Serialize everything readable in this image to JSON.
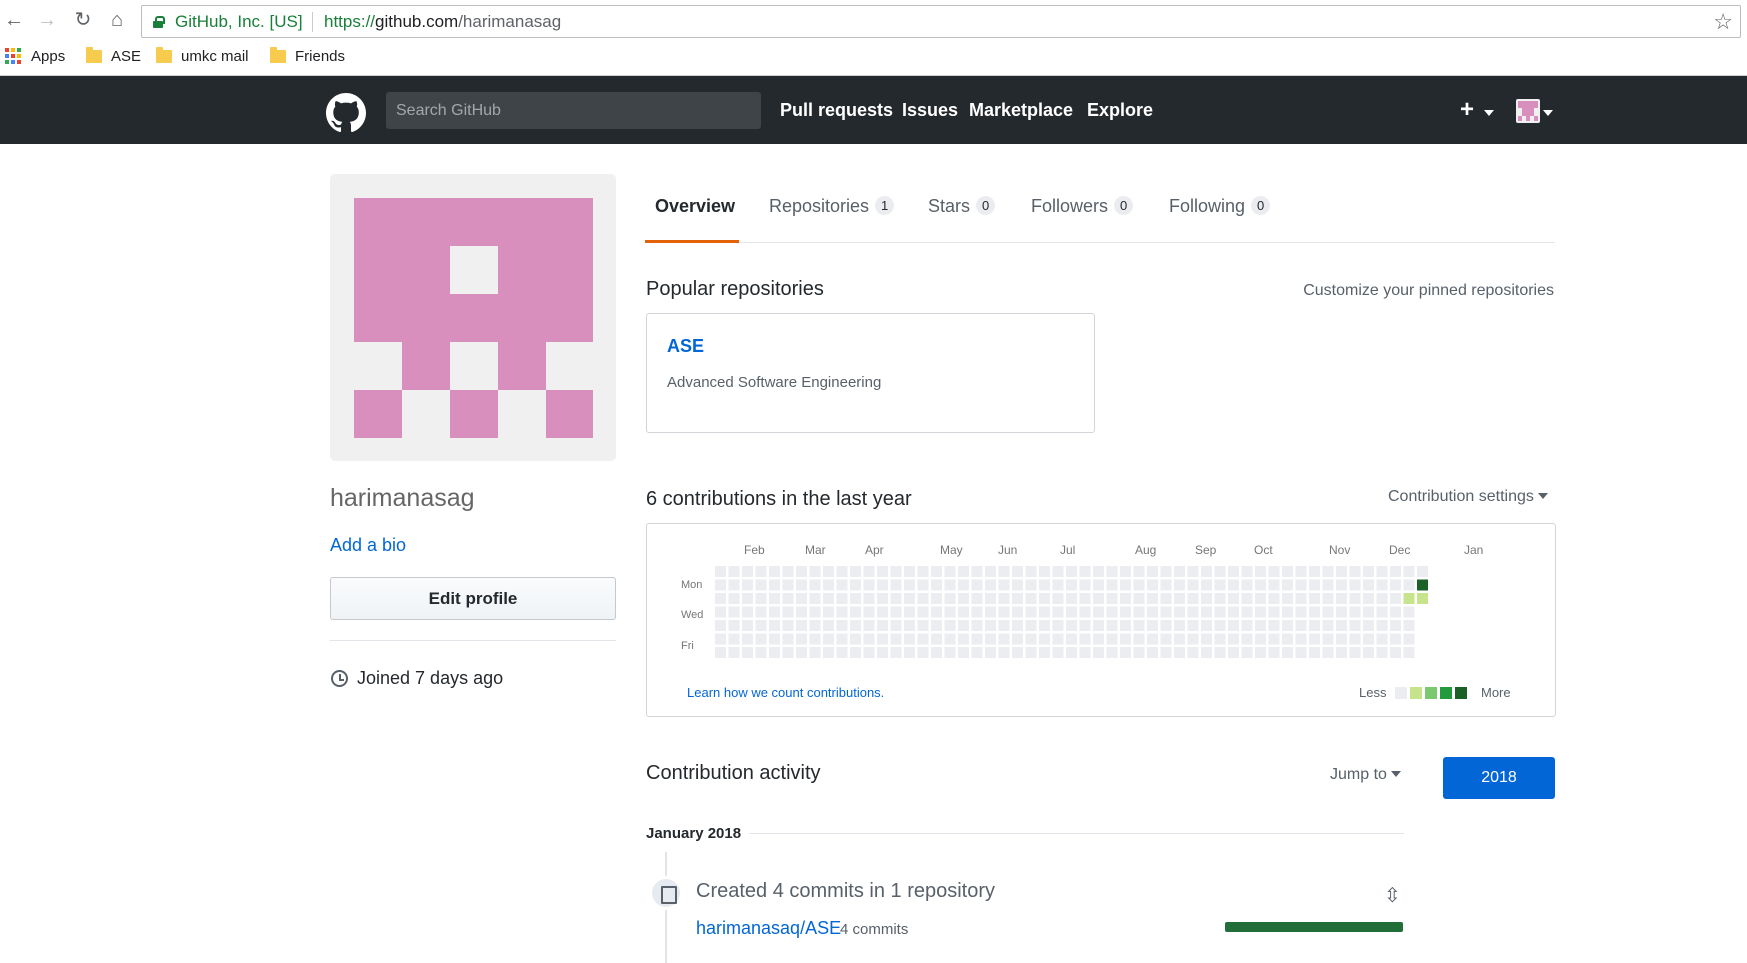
{
  "browser": {
    "site_identity": "GitHub, Inc. [US]",
    "url_scheme": "https://",
    "url_host": "github.com",
    "url_path": "/harimanasag",
    "bookmarks": [
      "Apps",
      "ASE",
      "umkc mail",
      "Friends"
    ]
  },
  "header": {
    "search_placeholder": "Search GitHub",
    "nav": [
      "Pull requests",
      "Issues",
      "Marketplace",
      "Explore"
    ],
    "new_menu": "+"
  },
  "profile": {
    "username": "harimanasag",
    "add_bio": "Add a bio",
    "edit_button": "Edit profile",
    "joined": "Joined 7 days ago"
  },
  "tabs": [
    {
      "label": "Overview",
      "count": null
    },
    {
      "label": "Repositories",
      "count": "1"
    },
    {
      "label": "Stars",
      "count": "0"
    },
    {
      "label": "Followers",
      "count": "0"
    },
    {
      "label": "Following",
      "count": "0"
    }
  ],
  "popular": {
    "title": "Popular repositories",
    "customize": "Customize your pinned repositories",
    "repos": [
      {
        "name": "ASE",
        "description": "Advanced Software Engineering"
      }
    ]
  },
  "contributions": {
    "title": "6 contributions in the last year",
    "settings": "Contribution settings",
    "months": [
      "Feb",
      "Mar",
      "Apr",
      "May",
      "Jun",
      "Jul",
      "Aug",
      "Sep",
      "Oct",
      "Nov",
      "Dec",
      "Jan"
    ],
    "weekdays": [
      "Mon",
      "Wed",
      "Fri"
    ],
    "learn_link": "Learn how we count contributions.",
    "legend_less": "Less",
    "legend_more": "More",
    "colors": [
      "#ebedf0",
      "#c6e48b",
      "#7bc96f",
      "#239a3b",
      "#196127"
    ],
    "weeks": 53,
    "active_days": [
      {
        "week": 52,
        "day": 1,
        "level": 4
      },
      {
        "week": 51,
        "day": 2,
        "level": 1
      },
      {
        "week": 52,
        "day": 2,
        "level": 1
      }
    ]
  },
  "activity": {
    "title": "Contribution activity",
    "jump_to": "Jump to",
    "year": "2018",
    "month_header": "January 2018",
    "summary": "Created 4 commits in 1 repository",
    "repo": "harimanasaq/ASE",
    "commits": "4 commits"
  }
}
